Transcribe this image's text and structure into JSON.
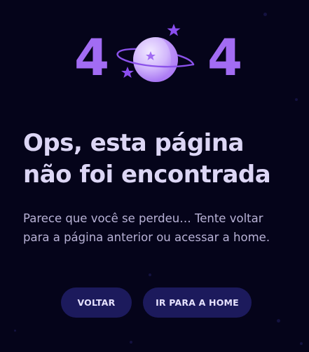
{
  "hero": {
    "digit_left": "4",
    "digit_right": "4",
    "colors": {
      "accent": "#a26cf3",
      "planet_light": "#e4d7ff",
      "planet_mid": "#b98df8",
      "background": "#05041a"
    }
  },
  "content": {
    "title_line1": "Ops, esta página",
    "title_line2": "não foi encontrada",
    "subtitle_line1": "Parece que você se perdeu… Tente voltar",
    "subtitle_line2": "para a página anterior ou acessar a home."
  },
  "actions": {
    "back_label": "VOLTAR",
    "home_label": "IR PARA A HOME",
    "button_color": "#1c1a5c"
  }
}
